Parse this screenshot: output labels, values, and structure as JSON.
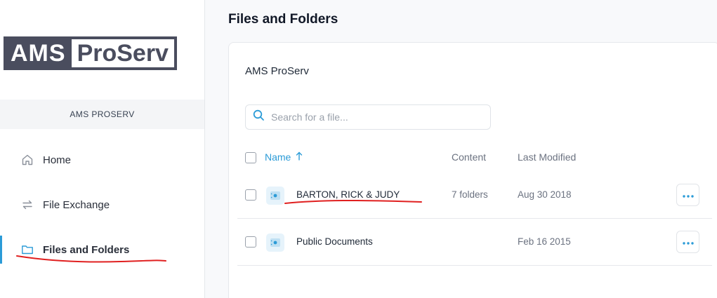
{
  "sidebar": {
    "logo": {
      "left": "AMS",
      "right": "ProServ"
    },
    "org_name": "AMS PROSERV",
    "items": [
      {
        "label": "Home",
        "icon": "home-icon"
      },
      {
        "label": "File Exchange",
        "icon": "exchange-icon"
      },
      {
        "label": "Files and Folders",
        "icon": "folder-icon",
        "active": true
      }
    ]
  },
  "main": {
    "page_title": "Files and Folders",
    "card_title": "AMS ProServ",
    "search": {
      "placeholder": "Search for a file..."
    },
    "columns": {
      "name": "Name",
      "content": "Content",
      "modified": "Last Modified"
    },
    "rows": [
      {
        "name": "BARTON, RICK & JUDY",
        "content": "7 folders",
        "modified": "Aug 30 2018"
      },
      {
        "name": "Public Documents",
        "content": "",
        "modified": "Feb 16 2015"
      }
    ]
  },
  "colors": {
    "accent": "#2b9bd7",
    "logo_dark": "#4a4d5e",
    "annotation": "#e02020"
  }
}
